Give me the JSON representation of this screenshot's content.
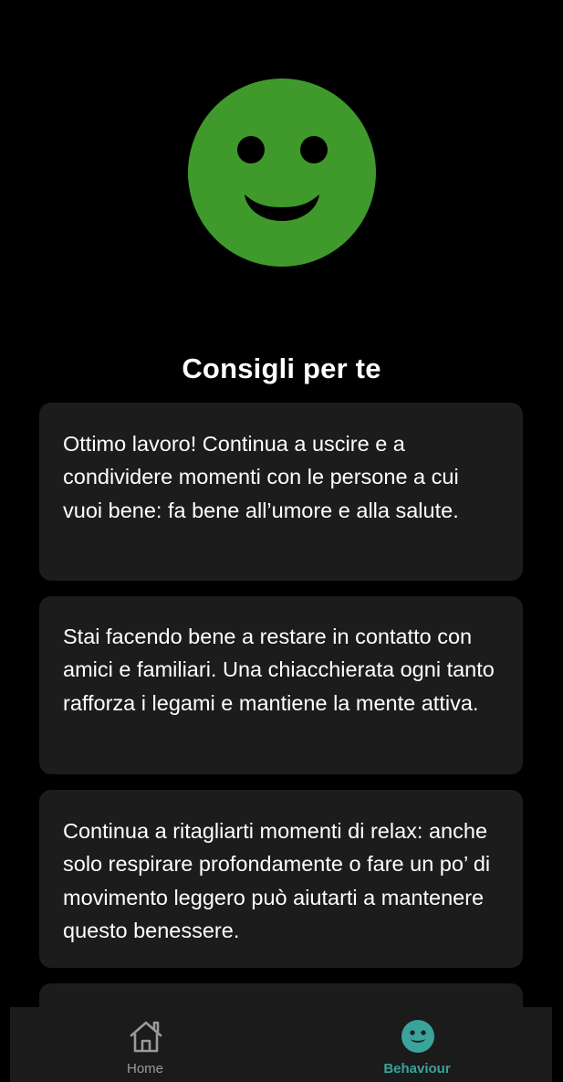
{
  "mood": {
    "icon": "happy-face-icon",
    "color": "#3f9a2b"
  },
  "section": {
    "title": "Consigli per te"
  },
  "tips": [
    {
      "text": "Ottimo lavoro! Continua a uscire e a condividere momenti con le persone a cui vuoi bene: fa bene all’umore e alla salute."
    },
    {
      "text": "Stai facendo bene a restare in contatto con amici e familiari. Una chiacchierata ogni tanto rafforza i legami e mantiene la mente attiva."
    },
    {
      "text": "Continua a ritagliarti momenti di relax: anche solo respirare profondamente o fare un po’ di movimento leggero può aiutarti a mantenere questo benessere."
    }
  ],
  "nav": {
    "items": [
      {
        "label": "Home",
        "icon": "home-icon",
        "active": false
      },
      {
        "label": "Behaviour",
        "icon": "smiley-icon",
        "active": true
      }
    ],
    "active_color": "#3aa39b",
    "inactive_color": "#9a9a9a"
  }
}
